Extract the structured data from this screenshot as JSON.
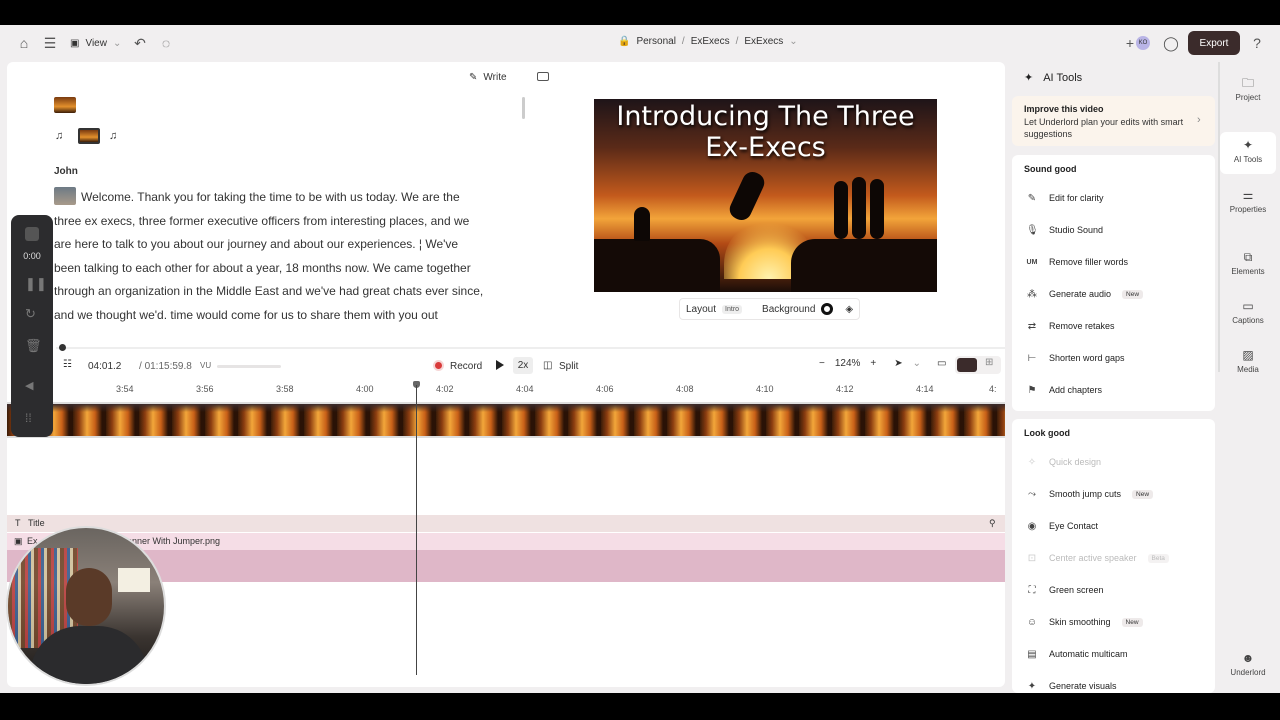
{
  "topbar": {
    "view_label": "View",
    "breadcrumb": [
      "Personal",
      "ExExecs",
      "ExExecs"
    ],
    "export_label": "Export",
    "avatar_initials": "KO"
  },
  "script": {
    "write_label": "Write",
    "speaker": "John",
    "transcript": "Welcome. Thank you for taking the time to be with us today. We are the three ex execs, three former executive officers from interesting places, and we are here to talk to you about our journey and about our experiences. ¦ We've been talking to each other for about a year, 18 months now. We came together through an organization in the Middle East and we've had great chats ever since, and we thought we'd. time would come for us to share them with you out"
  },
  "preview": {
    "title_line1": "Introducing The Three",
    "title_line2": "Ex-Execs",
    "layout_label": "Layout",
    "layout_badge": "Intro",
    "background_label": "Background"
  },
  "transport": {
    "current_time": "04:01.2",
    "total_time": "01:15:59.8",
    "vu_label": "VU",
    "record_label": "Record",
    "speed_label": "2x",
    "split_label": "Split",
    "zoom_label": "124%"
  },
  "ruler": {
    "ticks": [
      "3:54",
      "3:56",
      "3:58",
      "4:00",
      "4:02",
      "4:04",
      "4:06",
      "4:08",
      "4:10",
      "4:12",
      "4:14",
      "4:"
    ]
  },
  "tracks": {
    "title_label": "Title",
    "media_label_left": "Ex",
    "media_label_right": "anner With Jumper.png"
  },
  "float_bar": {
    "time": "0:00"
  },
  "ai_tools": {
    "title": "AI Tools",
    "improve_title": "Improve this video",
    "improve_desc": "Let Underlord plan your edits with smart suggestions",
    "sound_good": {
      "header": "Sound good",
      "items": [
        {
          "label": "Edit for clarity",
          "icon": "edit-wand-icon"
        },
        {
          "label": "Studio Sound",
          "icon": "microphone-icon"
        },
        {
          "label": "Remove filler words",
          "icon": "filler-words-icon"
        },
        {
          "label": "Generate audio",
          "icon": "sparkle-audio-icon",
          "badge": "New"
        },
        {
          "label": "Remove retakes",
          "icon": "retake-icon"
        },
        {
          "label": "Shorten word gaps",
          "icon": "word-gap-icon"
        },
        {
          "label": "Add chapters",
          "icon": "bookmark-icon"
        }
      ]
    },
    "look_good": {
      "header": "Look good",
      "items": [
        {
          "label": "Quick design",
          "icon": "wand-icon",
          "disabled": true
        },
        {
          "label": "Smooth jump cuts",
          "icon": "jump-cut-icon",
          "badge": "New"
        },
        {
          "label": "Eye Contact",
          "icon": "eye-icon"
        },
        {
          "label": "Center active speaker",
          "icon": "speaker-center-icon",
          "badge": "Beta",
          "disabled": true
        },
        {
          "label": "Green screen",
          "icon": "green-screen-icon"
        },
        {
          "label": "Skin smoothing",
          "icon": "face-icon",
          "badge": "New"
        },
        {
          "label": "Automatic multicam",
          "icon": "multicam-icon"
        },
        {
          "label": "Generate visuals",
          "icon": "sparkle-icon"
        }
      ]
    }
  },
  "rail": {
    "items": [
      "Project",
      "AI Tools",
      "Properties",
      "Elements",
      "Captions",
      "Media"
    ],
    "bottom": "Underlord"
  },
  "colors": {
    "accent_dark": "#3b2b2b",
    "record_red": "#d93a3a",
    "media_track": "#dfb7c8"
  }
}
